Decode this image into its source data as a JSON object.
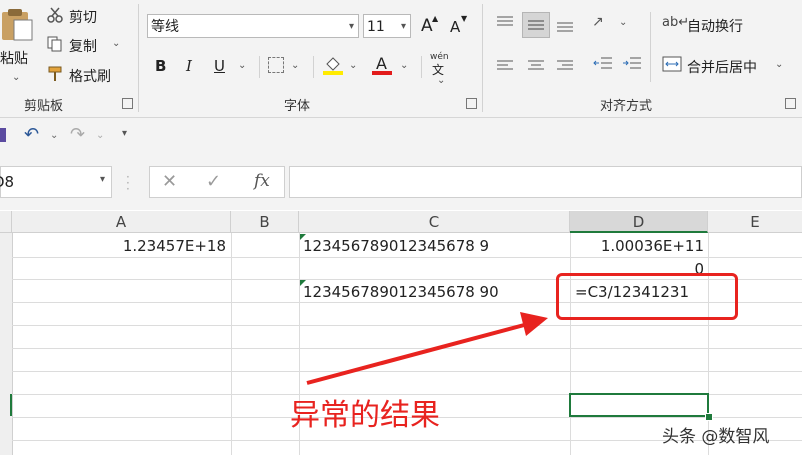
{
  "ribbon": {
    "clipboard": {
      "paste_label": "粘贴",
      "cut_label": "剪切",
      "copy_label": "复制",
      "format_painter_label": "格式刷",
      "group_label": "剪贴板"
    },
    "font": {
      "font_name": "等线",
      "font_size": "11",
      "bold": "B",
      "italic": "I",
      "underline": "U",
      "font_color_glyph": "A",
      "grow_glyph": "A",
      "shrink_glyph": "A",
      "phonetic_glyph": "wén",
      "group_label": "字体"
    },
    "alignment": {
      "wrap_text_label": "自动换行",
      "merge_center_label": "合并后居中",
      "group_label": "对齐方式"
    }
  },
  "formula_bar": {
    "name_box": "D8",
    "fx": "fx",
    "content": ""
  },
  "sheet": {
    "columns": [
      "A",
      "B",
      "C",
      "D",
      "E"
    ],
    "cells": {
      "a1": "1.23457E+18",
      "c1": "123456789012345678 9",
      "d1": "1.00036E+11",
      "d2": "0",
      "c3": "123456789012345678 90",
      "d3": "=C3/12341231"
    }
  },
  "annotation": {
    "text": "异常的结果",
    "color": "#e8231f"
  },
  "watermark": "头条 @数智风",
  "colors": {
    "ribbon_bg": "#f3f3f3",
    "selection_green": "#1f7a3c",
    "annotation_red": "#e8231f"
  }
}
